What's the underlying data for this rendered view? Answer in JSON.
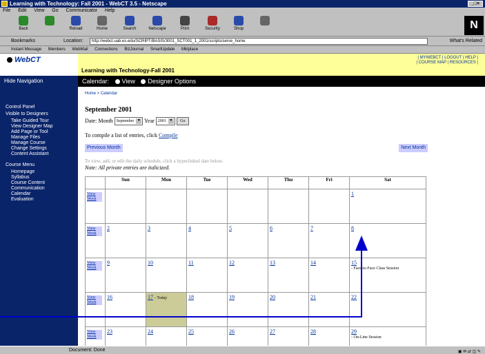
{
  "window": {
    "title": "Learning with Technology: Fall 2001 - WebCT 3.5 - Netscape",
    "controls": "_□×"
  },
  "menu": [
    "File",
    "Edit",
    "View",
    "Go",
    "Communicator",
    "Help"
  ],
  "toolbar": {
    "buttons": [
      {
        "label": "Back",
        "color": "#2a8a2a"
      },
      {
        "label": "",
        "color": "#2a8a2a"
      },
      {
        "label": "Reload",
        "color": "#2a4aaa"
      },
      {
        "label": "Home",
        "color": "#666666"
      },
      {
        "label": "Search",
        "color": "#2a4aaa"
      },
      {
        "label": "Netscape",
        "color": "#2a4aaa"
      },
      {
        "label": "Print",
        "color": "#444444"
      },
      {
        "label": "Security",
        "color": "#aa2a2a"
      },
      {
        "label": "Shop",
        "color": "#2a4aaa"
      },
      {
        "label": "",
        "color": "#666666"
      }
    ],
    "brand": "N"
  },
  "location": {
    "bookmarks": "Bookmarks",
    "label": "Location:",
    "url": "http://webct.uab.es.edu/SCRIPT/BASIS/3001_SCT001_1_2001/scripts/serve_home",
    "related": "What's Related"
  },
  "personal_bar": [
    "Instant Message",
    "Members",
    "WebMail",
    "Connections",
    "BizJournal",
    "SmartUpdate",
    "Mktplace"
  ],
  "webct": {
    "logo": "WebCT",
    "hide_nav": "Hide Navigation",
    "course_title": "Learning with Technology-Fall 2001",
    "toplinks_1": "| MYWEBCT | LOGOUT | HELP |",
    "toplinks_2": "| COURSE MAP | RESOURCES |",
    "bar": {
      "label": "Calendar:",
      "view": "View",
      "designer": "Designer Options"
    }
  },
  "sidebar": {
    "control_panel": "Control Panel",
    "visible": "Visible to Designers",
    "tools": [
      "Take Guided Tour",
      "View Designer Map",
      "Add Page or Tool",
      "Manage Files",
      "Manage Course",
      "Change Settings",
      "Content Assistant"
    ],
    "course_menu": "Course Menu",
    "menu_items": [
      "Homepage",
      "Syllabus",
      "Course Content",
      "Communication",
      "Calendar",
      "Evaluation"
    ]
  },
  "main": {
    "breadcrumb": "Home > Calendar",
    "month_title": "September 2001",
    "date_label": "Date:",
    "month_label": "Month",
    "month_value": "September",
    "year_label": "Year",
    "year_value": "2001",
    "go": "Go",
    "compile_text": "To compile a list of entries, click",
    "compile_link": "Compile",
    "prev": "Previous Month",
    "next": "Next Month",
    "hint": "To view, add, or edit the daily schedule, click a hyperlinked date below.",
    "note": "Note: All private entries are italicized."
  },
  "calendar": {
    "headers": [
      "Sun",
      "Mon",
      "Tue",
      "Wed",
      "Thu",
      "Fri",
      "Sat"
    ],
    "view_week": "View Week",
    "weeks": [
      {
        "days": [
          "",
          "",
          "",
          "",
          "",
          "",
          "1"
        ],
        "events": {}
      },
      {
        "days": [
          "2",
          "3",
          "4",
          "5",
          "6",
          "7",
          "8"
        ],
        "events": {}
      },
      {
        "days": [
          "9",
          "10",
          "11",
          "12",
          "13",
          "14",
          "15"
        ],
        "events": {
          "6": "- Face-to-Face Class Session"
        }
      },
      {
        "days": [
          "16",
          "17",
          "18",
          "19",
          "20",
          "21",
          "22"
        ],
        "events": {
          "1": "- Today"
        },
        "today": 1
      },
      {
        "days": [
          "23",
          "24",
          "25",
          "26",
          "27",
          "28",
          "29"
        ],
        "events": {
          "6": "- On-Line Session"
        }
      }
    ]
  },
  "status": {
    "text": "Document: Done"
  }
}
